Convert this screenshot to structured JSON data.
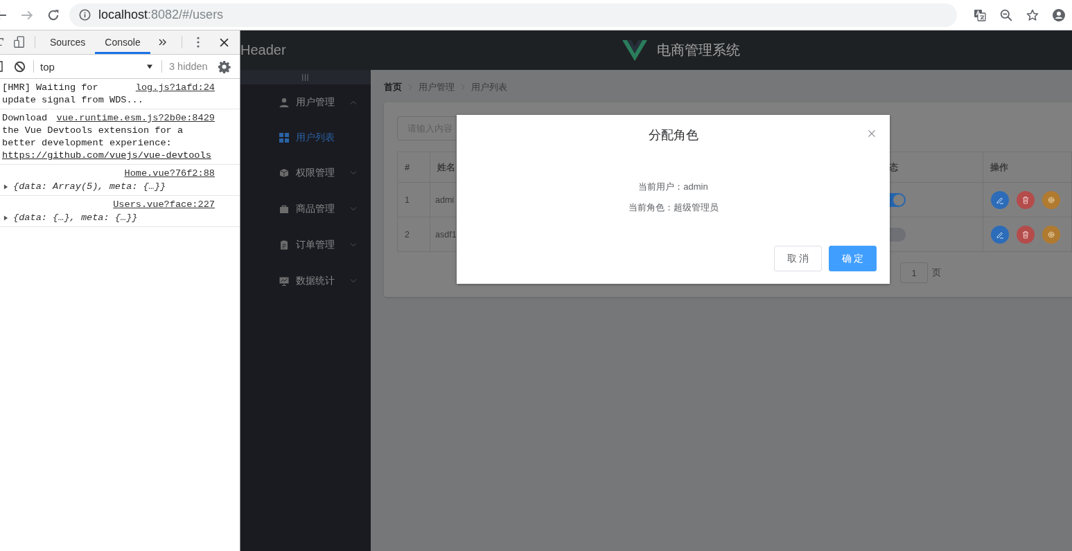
{
  "browser": {
    "url_host": "localhost",
    "url_path": ":8082/#/users"
  },
  "devtools": {
    "tabs": [
      {
        "label": "Sources",
        "selected": false
      },
      {
        "label": "Console",
        "selected": true
      }
    ],
    "context": "top",
    "hidden_count": "3 hidden",
    "messages": [
      {
        "kind": "text",
        "source": "log.js?1afd:24",
        "lines": [
          "[HMR] Waiting for",
          "update signal from WDS..."
        ]
      },
      {
        "kind": "text",
        "source": "vue.runtime.esm.js?2b0e:8429",
        "lines": [
          "Download",
          "the Vue Devtools extension for a",
          "better development experience:"
        ],
        "link": "https://github.com/vuejs/vue-devtools"
      },
      {
        "kind": "object",
        "source": "Home.vue?76f2:88",
        "text": "{data: Array(5), meta: {…}}",
        "expanded": false
      },
      {
        "kind": "object",
        "source": "Users.vue?face:227",
        "text": "{data: {…}, meta: {…}}",
        "expanded": false
      }
    ]
  },
  "app": {
    "header": {
      "left": "Header",
      "title": "电商管理系统"
    },
    "sidebar": {
      "toggle": "|||",
      "menus": [
        {
          "label": "用户管理",
          "expanded": true,
          "children": [
            {
              "label": "用户列表",
              "selected": true
            }
          ]
        },
        {
          "label": "权限管理",
          "expanded": false
        },
        {
          "label": "商品管理",
          "expanded": false
        },
        {
          "label": "订单管理",
          "expanded": false
        },
        {
          "label": "数据统计",
          "expanded": false
        }
      ]
    },
    "breadcrumb": [
      "首页",
      "用户管理",
      "用户列表"
    ],
    "search": {
      "placeholder": "请输入内容"
    },
    "table": {
      "columns": [
        "#",
        "姓名",
        "态",
        "操作"
      ],
      "rows": [
        {
          "index": "1",
          "name": "admi",
          "on": true
        },
        {
          "index": "2",
          "name": "asdf1",
          "on": false
        }
      ]
    },
    "pagination": {
      "page": "1",
      "suffix": "页"
    },
    "dialog": {
      "title": "分配角色",
      "lines": [
        "当前用户：admin",
        "当前角色：超级管理员"
      ],
      "buttons": [
        {
          "label": "取 消",
          "kind": "default"
        },
        {
          "label": "确 定",
          "kind": "primary"
        }
      ]
    }
  }
}
